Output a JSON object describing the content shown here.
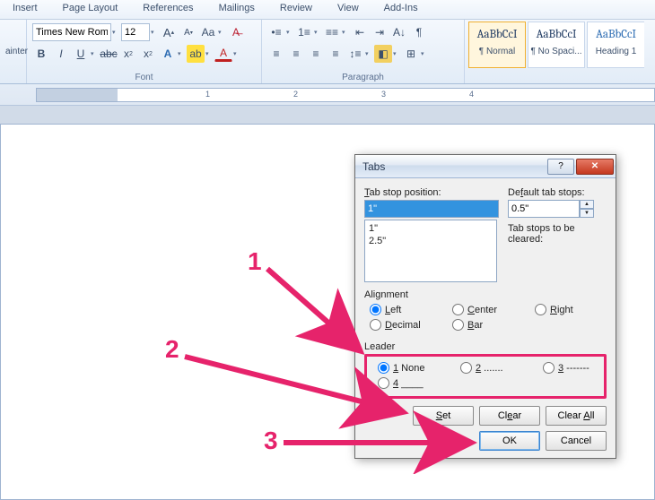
{
  "ribbon": {
    "tabs": [
      "Insert",
      "Page Layout",
      "References",
      "Mailings",
      "Review",
      "View",
      "Add-Ins"
    ],
    "font_name": "Times New Rom",
    "font_size": "12",
    "painter_label": "ainter",
    "group_font": "Font",
    "group_para": "Paragraph"
  },
  "styles": {
    "sample": "AaBbCcI",
    "items": [
      "¶ Normal",
      "¶ No Spaci...",
      "Heading 1"
    ]
  },
  "ruler": {
    "n1": "1",
    "n2": "2",
    "n3": "3",
    "n4": "4"
  },
  "dialog": {
    "title": "Tabs",
    "tab_stop_label": "Tab stop position:",
    "tab_stop_value": "1\"",
    "list": [
      "1\"",
      "2.5\""
    ],
    "default_label": "Default tab stops:",
    "default_value": "0.5\"",
    "cleared_label": "Tab stops to be cleared:",
    "alignment_label": "Alignment",
    "align": {
      "left": "Left",
      "center": "Center",
      "right": "Right",
      "decimal": "Decimal",
      "bar": "Bar"
    },
    "leader_label": "Leader",
    "leader": {
      "l1": "1 None",
      "l2": "2 .......",
      "l3": "3 -------",
      "l4": "4 ____"
    },
    "set": "Set",
    "clear": "Clear",
    "clear_all": "Clear All",
    "ok": "OK",
    "cancel": "Cancel"
  },
  "annotations": {
    "a1": "1",
    "a2": "2",
    "a3": "3"
  }
}
